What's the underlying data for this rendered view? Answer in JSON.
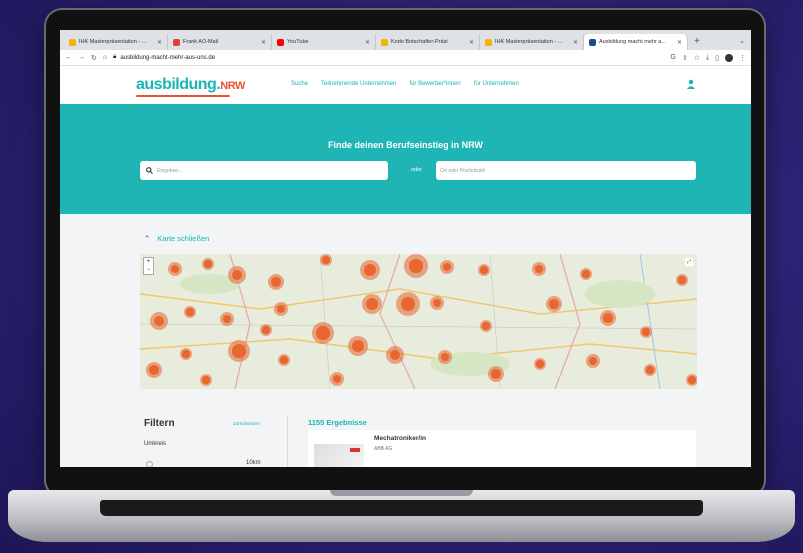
{
  "browser": {
    "tabs": [
      {
        "title": "IHK Masterpräsentation - ...",
        "favicon_color": "#f4b400",
        "active": false
      },
      {
        "title": "Frank AO-Mail",
        "favicon_color": "#db4437",
        "active": false
      },
      {
        "title": "YouTube",
        "favicon_color": "#ff0000",
        "active": false
      },
      {
        "title": "Kodo Botschafter-Präsi",
        "favicon_color": "#f4b400",
        "active": false
      },
      {
        "title": "IHK Masterpräsentation - ...",
        "favicon_color": "#f4b400",
        "active": false
      },
      {
        "title": "Ausbildung macht mehr a...",
        "favicon_color": "#1a4d8f",
        "active": true
      }
    ],
    "new_tab": "+",
    "tab_menu": "⌄",
    "url": "ausbildung-macht-mehr-aus-uns.de"
  },
  "site": {
    "logo_main": "ausbildung.",
    "logo_nrw": "NRW",
    "nav": [
      "Suche",
      "Teilnehmende Unternehmen",
      "für Bewerber*innen",
      "für Unternehmen"
    ],
    "hero_title": "Finde deinen Berufseinstieg in NRW",
    "search_placeholder": "Eingeben...",
    "oder": "oder",
    "location_placeholder": "Ort oder Postleitzahl",
    "map_toggle": "Karte schließen",
    "map_zoom_in": "+",
    "map_zoom_out": "−",
    "filter_title": "Filtern",
    "filter_reset": "Zurücksetzen",
    "umkreis": "Umkreis",
    "radius_option": "10km",
    "results_count": "1155 Ergebnisse",
    "result": {
      "title": "Mechatroniker/in",
      "company": "ABB AG"
    }
  },
  "colors": {
    "accent": "#1fb5b5",
    "brand_orange": "#e8532f",
    "cluster": "#e8662f"
  }
}
